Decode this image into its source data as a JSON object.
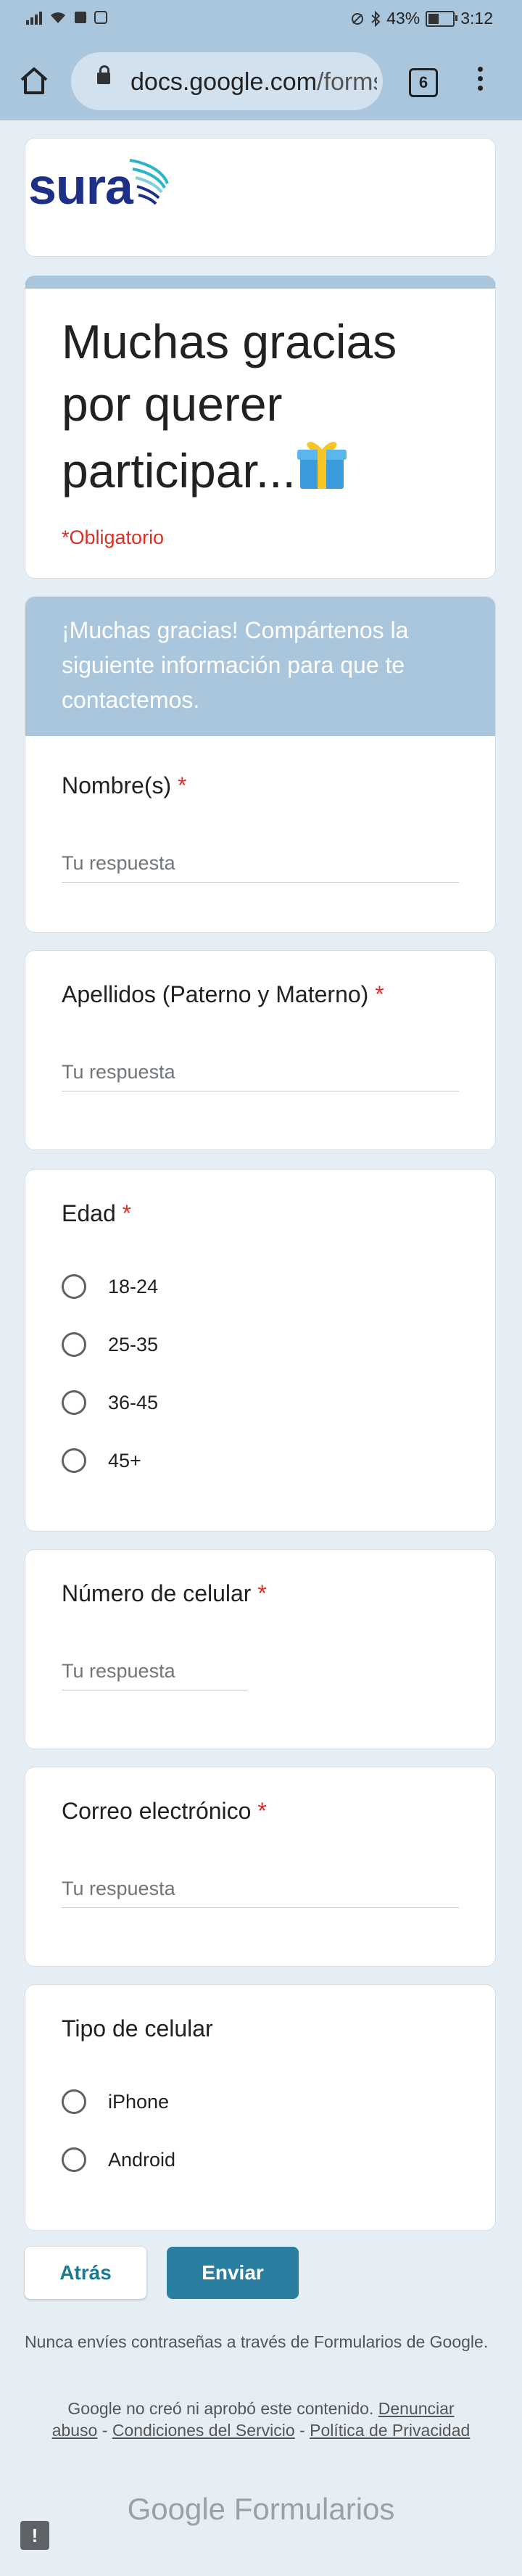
{
  "status_bar": {
    "battery": "43%",
    "time": "3:12",
    "battery_level": 0.43
  },
  "browser": {
    "url_domain": "docs.google.com",
    "url_path": "/forms",
    "tab_count": "6"
  },
  "brand": {
    "logo_text": "sura"
  },
  "form": {
    "title": "Muchas gracias por querer participar...",
    "required_note": "*Obligatorio",
    "section_description": "¡Muchas gracias! Compártenos la siguiente información para que te contactemos.",
    "required_mark": "*",
    "placeholder": "Tu respuesta",
    "questions": {
      "nombre": {
        "title": "Nombre(s)"
      },
      "apellidos": {
        "title": "Apellidos (Paterno y Materno)"
      },
      "edad": {
        "title": "Edad",
        "options": [
          "18-24",
          "25-35",
          "36-45",
          "45+"
        ]
      },
      "celular": {
        "title": "Número de celular"
      },
      "correo": {
        "title": "Correo electrónico"
      },
      "tipo": {
        "title": "Tipo de celular",
        "options": [
          "iPhone",
          "Android"
        ]
      }
    },
    "back_label": "Atrás",
    "submit_label": "Enviar",
    "password_warning": "Nunca envíes contraseñas a través de Formularios de Google.",
    "disclaimer_text": "Google no creó ni aprobó este contenido.",
    "report_link": "Denunciar abuso",
    "terms_link": "Condiciones del Servicio",
    "privacy_link": "Política de Privacidad",
    "footer_google": "Google",
    "footer_product": "Formularios"
  },
  "colors": {
    "accent": "#a9c6dd",
    "button": "#2a7fa0",
    "required": "#d93025",
    "brand": "#1d2f86"
  }
}
